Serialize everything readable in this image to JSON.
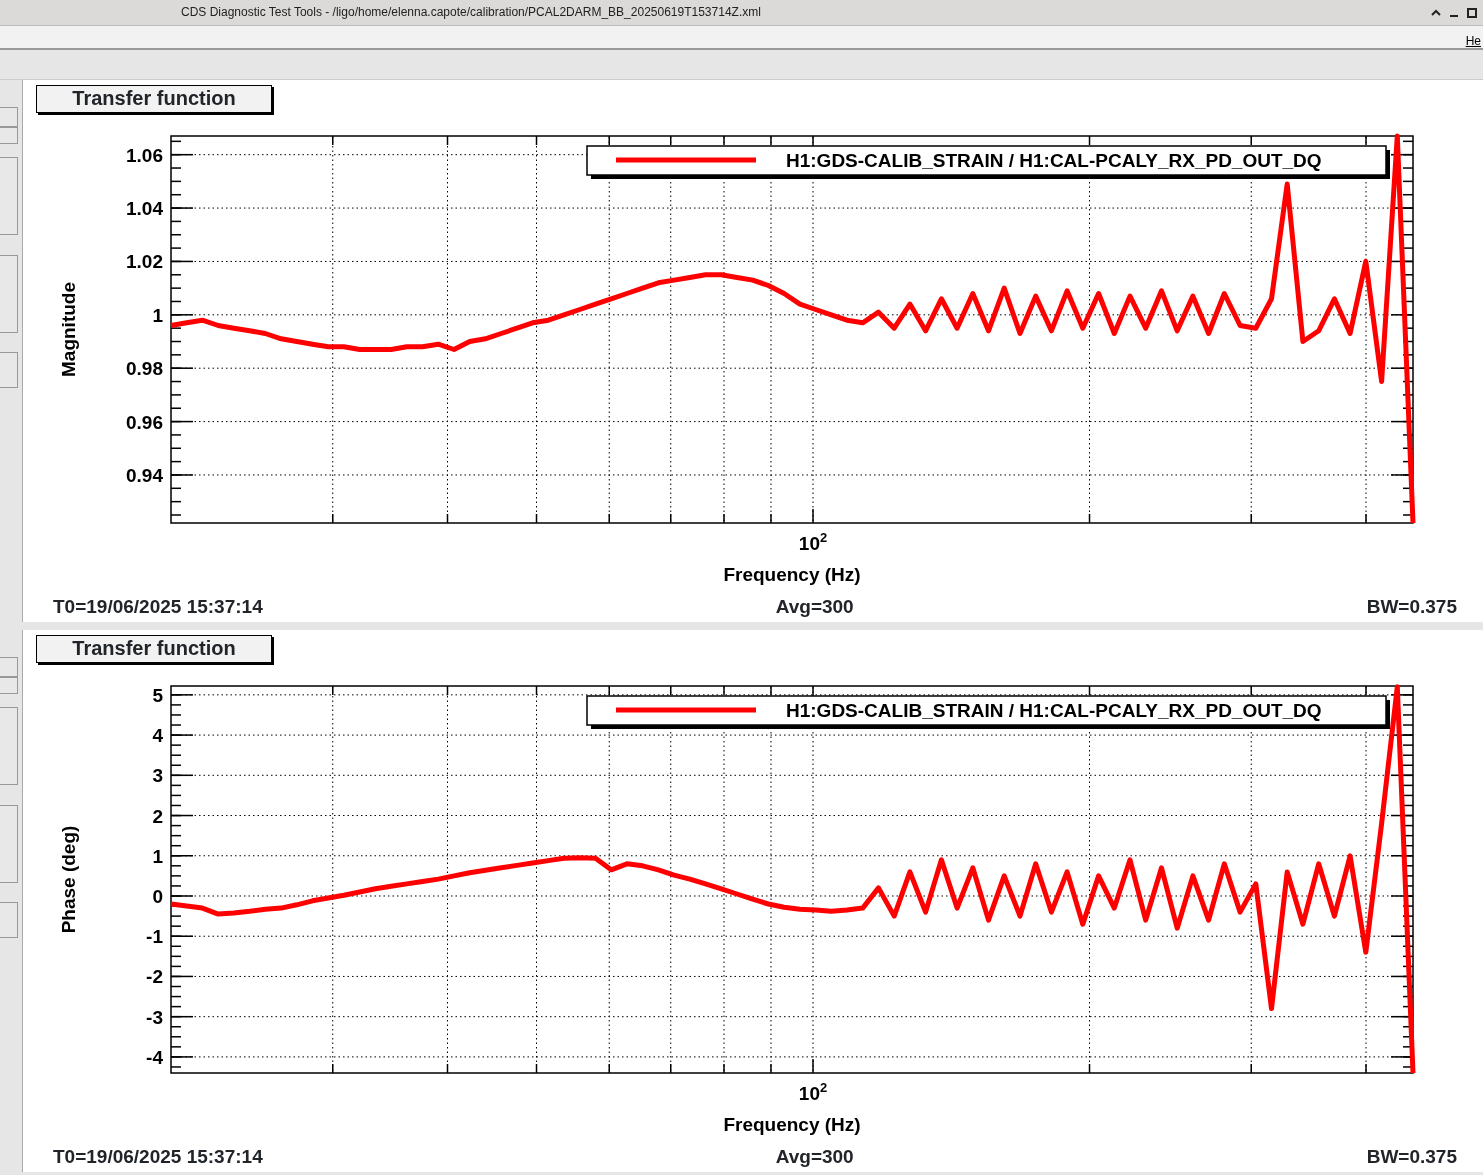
{
  "window": {
    "title": "CDS Diagnostic Test Tools - /ligo/home/elenna.capote/calibration/PCAL2DARM_BB_20250619T153714Z.xml"
  },
  "menu_bar": {
    "items": [
      "He"
    ]
  },
  "pads": [
    {
      "title": "Transfer function",
      "chart_data": {
        "type": "line",
        "xlabel": "Frequency (Hz)",
        "ylabel": "Magnitude",
        "grid": true,
        "series": [
          {
            "name": "H1:GDS-CALIB_STRAIN / H1:CAL-PCALY_RX_PD_OUT_DQ",
            "color": "#ff0000",
            "values": [
              0.996,
              0.997,
              0.998,
              0.996,
              0.995,
              0.994,
              0.993,
              0.991,
              0.99,
              0.989,
              0.988,
              0.988,
              0.987,
              0.987,
              0.987,
              0.988,
              0.988,
              0.989,
              0.987,
              0.99,
              0.991,
              0.993,
              0.995,
              0.997,
              0.998,
              1.0,
              1.002,
              1.004,
              1.006,
              1.008,
              1.01,
              1.012,
              1.013,
              1.014,
              1.015,
              1.015,
              1.014,
              1.013,
              1.011,
              1.008,
              1.004,
              1.002,
              1.0,
              0.998,
              0.997,
              1.001,
              0.995,
              1.004,
              0.994,
              1.006,
              0.995,
              1.008,
              0.994,
              1.01,
              0.993,
              1.007,
              0.994,
              1.009,
              0.995,
              1.008,
              0.993,
              1.007,
              0.995,
              1.009,
              0.994,
              1.007,
              0.993,
              1.008,
              0.996,
              0.995,
              1.006,
              1.049,
              0.99,
              0.994,
              1.006,
              0.993,
              1.02,
              0.975,
              1.067,
              0.922
            ]
          }
        ],
        "annotations": [
          "10$^{2}$"
        ],
        "ylim": [
          0.922,
          1.067
        ],
        "yticks": [
          {
            "value": 0.94,
            "label": "0.94"
          },
          {
            "value": 0.96,
            "label": "0.96"
          },
          {
            "value": 0.98,
            "label": "0.98"
          },
          {
            "value": 1,
            "label": "1"
          },
          {
            "value": 1.02,
            "label": "1.02"
          },
          {
            "value": 1.04,
            "label": "1.04"
          },
          {
            "value": 1.06,
            "label": "1.06"
          }
        ]
      },
      "footer": {
        "t0": "T0=19/06/2025 15:37:14",
        "avg": "Avg=300",
        "bw": "BW=0.375"
      }
    },
    {
      "title": "Transfer function",
      "chart_data": {
        "type": "line",
        "xlabel": "Frequency (Hz)",
        "ylabel": "Phase (deg)",
        "grid": true,
        "series": [
          {
            "name": "H1:GDS-CALIB_STRAIN / H1:CAL-PCALY_RX_PD_OUT_DQ",
            "color": "#ff0000",
            "values": [
              -0.2,
              -0.25,
              -0.3,
              -0.45,
              -0.42,
              -0.38,
              -0.33,
              -0.3,
              -0.22,
              -0.12,
              -0.05,
              0.02,
              0.1,
              0.18,
              0.24,
              0.3,
              0.36,
              0.42,
              0.5,
              0.58,
              0.64,
              0.7,
              0.76,
              0.82,
              0.88,
              0.94,
              0.95,
              0.94,
              0.65,
              0.8,
              0.75,
              0.65,
              0.52,
              0.42,
              0.3,
              0.18,
              0.05,
              -0.08,
              -0.2,
              -0.28,
              -0.33,
              -0.35,
              -0.38,
              -0.35,
              -0.3,
              0.2,
              -0.5,
              0.6,
              -0.4,
              0.9,
              -0.3,
              0.7,
              -0.6,
              0.5,
              -0.5,
              0.8,
              -0.4,
              0.6,
              -0.7,
              0.5,
              -0.3,
              0.9,
              -0.6,
              0.7,
              -0.8,
              0.5,
              -0.6,
              0.8,
              -0.4,
              0.3,
              -2.8,
              0.6,
              -0.7,
              0.8,
              -0.5,
              1.0,
              -1.4,
              1.8,
              5.2,
              -4.4
            ]
          }
        ],
        "annotations": [
          "10$^{2}$"
        ],
        "ylim": [
          -4.4,
          5.22
        ],
        "yticks": [
          {
            "value": -4,
            "label": "-4"
          },
          {
            "value": -3,
            "label": "-3"
          },
          {
            "value": -2,
            "label": "-2"
          },
          {
            "value": -1,
            "label": "-1"
          },
          {
            "value": 0,
            "label": "0"
          },
          {
            "value": 1,
            "label": "1"
          },
          {
            "value": 2,
            "label": "2"
          },
          {
            "value": 3,
            "label": "3"
          },
          {
            "value": 4,
            "label": "4"
          },
          {
            "value": 5,
            "label": "5"
          }
        ]
      },
      "footer": {
        "t0": "T0=19/06/2025 15:37:14",
        "avg": "Avg=300",
        "bw": "BW=0.375"
      }
    }
  ]
}
